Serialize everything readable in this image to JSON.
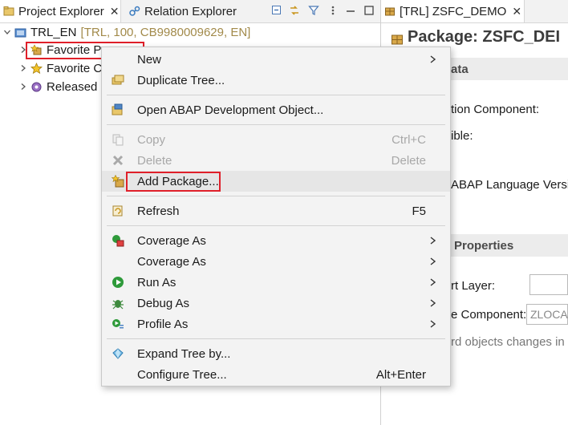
{
  "left": {
    "tabs": [
      {
        "label": "Project Explorer",
        "close": "✕"
      },
      {
        "label": "Relation Explorer"
      }
    ],
    "tree": {
      "root": {
        "label": "TRL_EN",
        "details": "[TRL, 100, CB9980009629, EN]"
      },
      "children": [
        {
          "label": "Favorite P"
        },
        {
          "label": "Favorite C"
        },
        {
          "label": "Released"
        }
      ]
    }
  },
  "right": {
    "tab": {
      "label": "[TRL] ZSFC_DEMO",
      "close": "✕"
    },
    "title": "Package: ZSFC_DEI",
    "section1": "ata",
    "row1": "tion Component:",
    "row2": "ible:",
    "row3": "ABAP Language Versi",
    "section2": "Properties",
    "row4": "rt Layer:",
    "row5": "e Component:",
    "field5_value": "ZLOCA",
    "row6": "rd objects changes in"
  },
  "menu": {
    "new": "New",
    "duplicate_tree": "Duplicate Tree...",
    "open_abap": "Open ABAP Development Object...",
    "copy": "Copy",
    "copy_shortcut": "Ctrl+C",
    "delete": "Delete",
    "delete_shortcut": "Delete",
    "add_package": "Add Package...",
    "refresh": "Refresh",
    "refresh_shortcut": "F5",
    "coverage_as_1": "Coverage As",
    "coverage_as_2": "Coverage As",
    "run_as": "Run As",
    "debug_as": "Debug As",
    "profile_as": "Profile As",
    "expand_tree": "Expand Tree by...",
    "configure_tree": "Configure Tree...",
    "configure_shortcut": "Alt+Enter"
  },
  "colors": {
    "highlight_box": "#e0202a",
    "menu_background": "#f3f3f3",
    "run_icon": "#2e9a3a",
    "package_icon": "#c79a3b"
  }
}
